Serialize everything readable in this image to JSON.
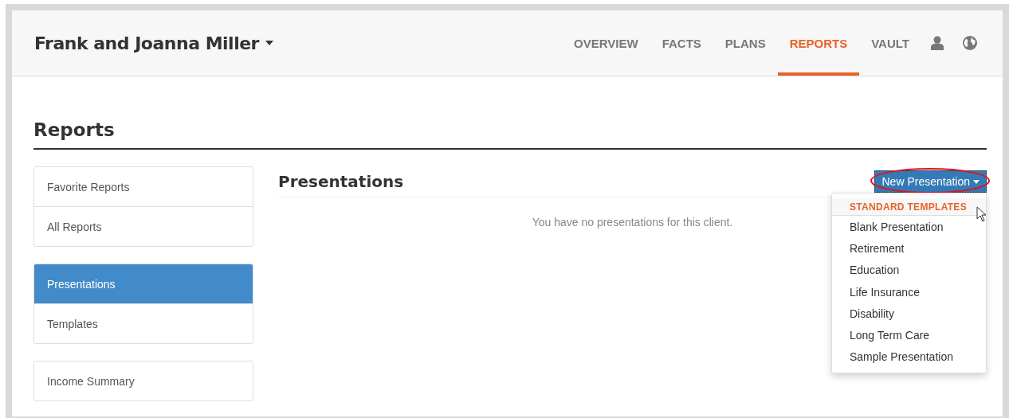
{
  "header": {
    "client_name": "Frank and Joanna Miller",
    "nav": [
      {
        "label": "OVERVIEW",
        "selected": false
      },
      {
        "label": "FACTS",
        "selected": false
      },
      {
        "label": "PLANS",
        "selected": false
      },
      {
        "label": "REPORTS",
        "selected": true
      },
      {
        "label": "VAULT",
        "selected": false
      }
    ]
  },
  "page_title": "Reports",
  "sidebar": {
    "groups": [
      [
        {
          "label": "Favorite Reports",
          "selected": false
        },
        {
          "label": "All Reports",
          "selected": false
        }
      ],
      [
        {
          "label": "Presentations",
          "selected": true
        },
        {
          "label": "Templates",
          "selected": false
        }
      ],
      [
        {
          "label": "Income Summary",
          "selected": false
        }
      ]
    ]
  },
  "main": {
    "title": "Presentations",
    "empty_message": "You have no presentations for this client.",
    "new_button": "New Presentation",
    "dropdown": [
      {
        "kind": "header",
        "label": "STANDARD TEMPLATES"
      },
      {
        "kind": "item",
        "label": "Blank Presentation"
      },
      {
        "kind": "item",
        "label": "Retirement"
      },
      {
        "kind": "item",
        "label": "Education"
      },
      {
        "kind": "item",
        "label": "Life Insurance"
      },
      {
        "kind": "item",
        "label": "Disability"
      },
      {
        "kind": "item",
        "label": "Long Term Care"
      },
      {
        "kind": "item",
        "label": "Sample Presentation"
      }
    ]
  }
}
